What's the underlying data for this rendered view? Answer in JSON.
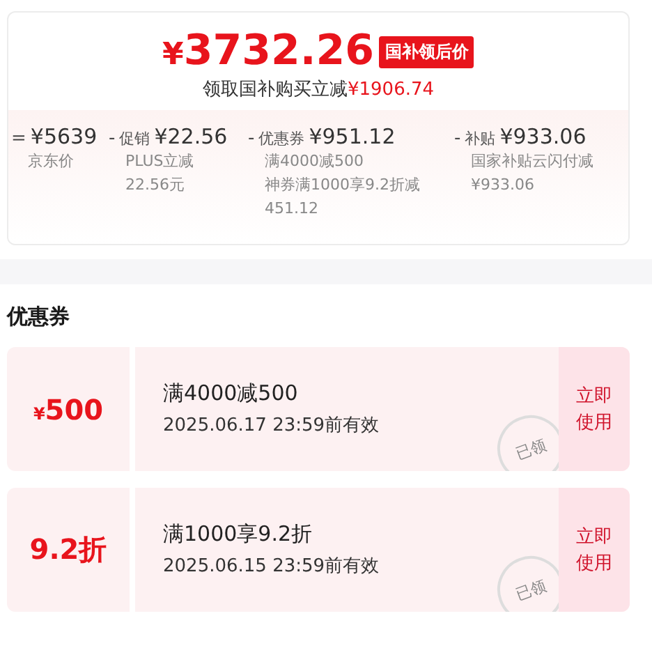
{
  "price": {
    "currency": "¥",
    "amount": "3732.26",
    "badge": "国补领后价",
    "subtitle": "领取国补购买立减",
    "saving": "¥1906.74"
  },
  "breakdown": [
    {
      "op": "=",
      "amount": "¥5639",
      "notes": [
        "京东价"
      ]
    },
    {
      "op": "-",
      "label": "促销",
      "amount": "¥22.56",
      "notes": [
        "PLUS立减",
        "22.56元"
      ]
    },
    {
      "op": "-",
      "label": "优惠券",
      "amount": "¥951.12",
      "notes": [
        "满4000减500",
        "神券满1000享9.2折减451.12"
      ]
    },
    {
      "op": "-",
      "label": "补贴",
      "amount": "¥933.06",
      "notes": [
        "国家补贴云闪付减",
        "¥933.06"
      ]
    }
  ],
  "section_title": "优惠券",
  "coupons": [
    {
      "kind": "cash",
      "currency": "¥",
      "value": "500",
      "title": "满4000减500",
      "validity": "2025.06.17 23:59前有效",
      "stamp": "已领",
      "action": "立即使用"
    },
    {
      "kind": "discount",
      "value": "9.2折",
      "title": "满1000享9.2折",
      "validity": "2025.06.15 23:59前有效",
      "stamp": "已领",
      "action": "立即使用"
    }
  ]
}
